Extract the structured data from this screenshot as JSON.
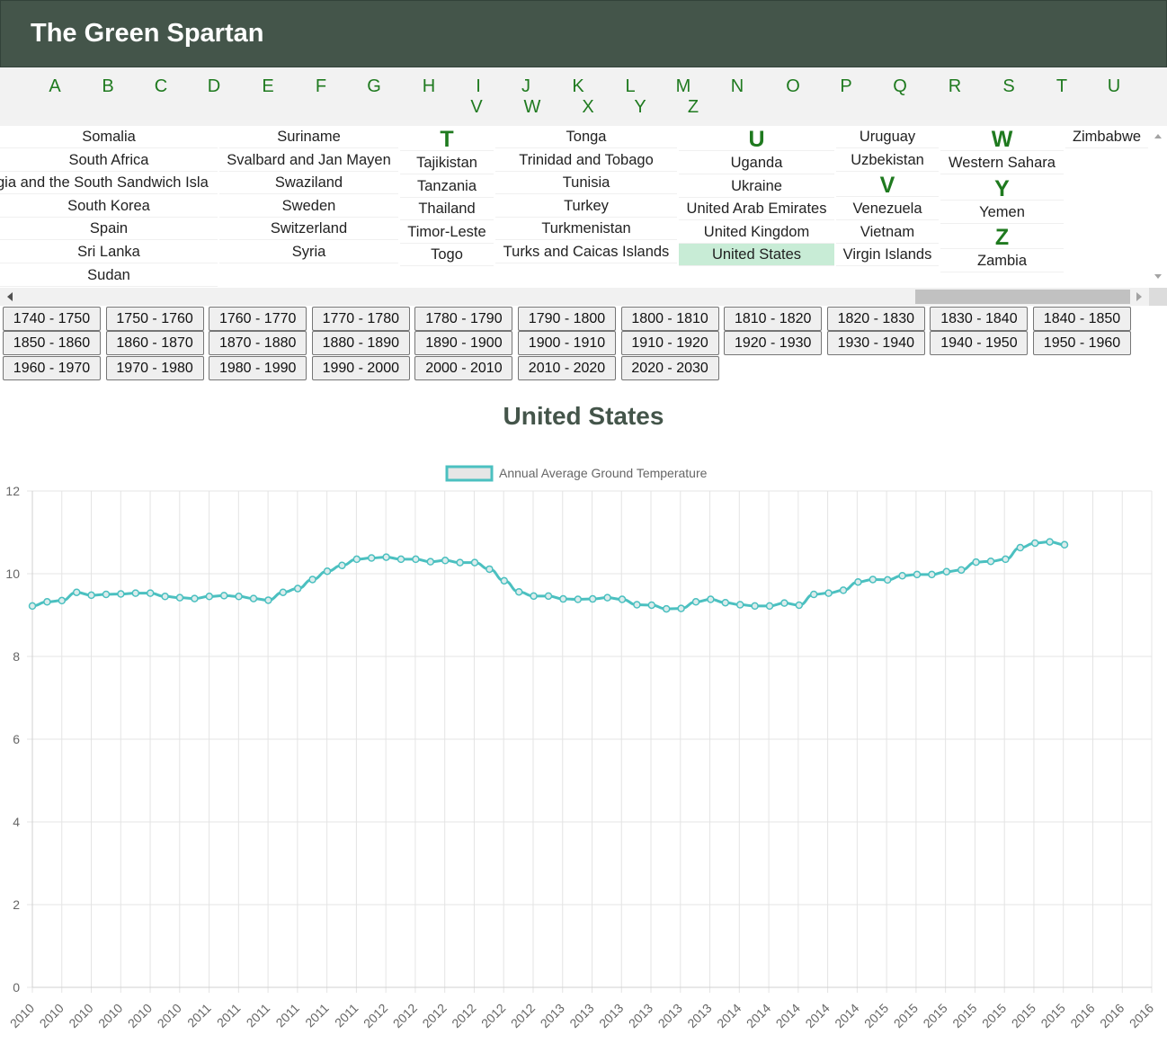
{
  "site": {
    "title": "The Green Spartan"
  },
  "alphabet": [
    "A",
    "B",
    "C",
    "D",
    "E",
    "F",
    "G",
    "H",
    "I",
    "J",
    "K",
    "L",
    "M",
    "N",
    "O",
    "P",
    "Q",
    "R",
    "S",
    "T",
    "U",
    "V",
    "W",
    "X",
    "Y",
    "Z"
  ],
  "country_columns": [
    {
      "entries": [
        {
          "type": "country",
          "name": "Somalia"
        },
        {
          "type": "country",
          "name": "South Africa"
        },
        {
          "type": "country",
          "name": "gia and the South Sandwich Isla"
        },
        {
          "type": "country",
          "name": "South Korea"
        },
        {
          "type": "country",
          "name": "Spain"
        },
        {
          "type": "country",
          "name": "Sri Lanka"
        },
        {
          "type": "country",
          "name": "Sudan"
        }
      ]
    },
    {
      "entries": [
        {
          "type": "country",
          "name": "Suriname"
        },
        {
          "type": "country",
          "name": "Svalbard and Jan Mayen"
        },
        {
          "type": "country",
          "name": "Swaziland"
        },
        {
          "type": "country",
          "name": "Sweden"
        },
        {
          "type": "country",
          "name": "Switzerland"
        },
        {
          "type": "country",
          "name": "Syria"
        }
      ]
    },
    {
      "entries": [
        {
          "type": "letter",
          "name": "T"
        },
        {
          "type": "country",
          "name": "Tajikistan"
        },
        {
          "type": "country",
          "name": "Tanzania"
        },
        {
          "type": "country",
          "name": "Thailand"
        },
        {
          "type": "country",
          "name": "Timor-Leste"
        },
        {
          "type": "country",
          "name": "Togo"
        }
      ]
    },
    {
      "entries": [
        {
          "type": "country",
          "name": "Tonga"
        },
        {
          "type": "country",
          "name": "Trinidad and Tobago"
        },
        {
          "type": "country",
          "name": "Tunisia"
        },
        {
          "type": "country",
          "name": "Turkey"
        },
        {
          "type": "country",
          "name": "Turkmenistan"
        },
        {
          "type": "country",
          "name": "Turks and Caicas Islands"
        }
      ]
    },
    {
      "entries": [
        {
          "type": "letter",
          "name": "U"
        },
        {
          "type": "country",
          "name": "Uganda"
        },
        {
          "type": "country",
          "name": "Ukraine"
        },
        {
          "type": "country",
          "name": "United Arab Emirates"
        },
        {
          "type": "country",
          "name": "United Kingdom"
        },
        {
          "type": "country",
          "name": "United States",
          "selected": true
        }
      ]
    },
    {
      "entries": [
        {
          "type": "country",
          "name": "Uruguay"
        },
        {
          "type": "country",
          "name": "Uzbekistan"
        },
        {
          "type": "letter",
          "name": "V"
        },
        {
          "type": "country",
          "name": "Venezuela"
        },
        {
          "type": "country",
          "name": "Vietnam"
        },
        {
          "type": "country",
          "name": "Virgin Islands"
        }
      ]
    },
    {
      "entries": [
        {
          "type": "letter",
          "name": "W"
        },
        {
          "type": "country",
          "name": "Western Sahara"
        },
        {
          "type": "letter",
          "name": "Y"
        },
        {
          "type": "country",
          "name": "Yemen"
        },
        {
          "type": "letter",
          "name": "Z"
        },
        {
          "type": "country",
          "name": "Zambia"
        }
      ]
    },
    {
      "entries": [
        {
          "type": "country",
          "name": "Zimbabwe"
        }
      ]
    }
  ],
  "decades": [
    "1740 - 1750",
    "1750 - 1760",
    "1760 - 1770",
    "1770 - 1780",
    "1780 - 1790",
    "1790 - 1800",
    "1800 - 1810",
    "1810 - 1820",
    "1820 - 1830",
    "1830 - 1840",
    "1840 - 1850",
    "1850 - 1860",
    "1860 - 1870",
    "1870 - 1880",
    "1880 - 1890",
    "1890 - 1900",
    "1900 - 1910",
    "1910 - 1920",
    "1920 - 1930",
    "1930 - 1940",
    "1940 - 1950",
    "1950 - 1960",
    "1960 - 1970",
    "1970 - 1980",
    "1980 - 1990",
    "1990 - 2000",
    "2000 - 2010",
    "2010 - 2020",
    "2020 - 2030"
  ],
  "chart_data": {
    "type": "line",
    "title": "United States",
    "xlabel": "",
    "ylabel": "",
    "ylim": [
      0,
      12
    ],
    "yticks": [
      0,
      2,
      4,
      6,
      8,
      10,
      12
    ],
    "grid": true,
    "legend_placement": "top",
    "x": [
      "2010",
      "2010",
      "2010",
      "2010",
      "2010",
      "2010",
      "2011",
      "2011",
      "2011",
      "2011",
      "2011",
      "2011",
      "2012",
      "2012",
      "2012",
      "2012",
      "2012",
      "2012",
      "2013",
      "2013",
      "2013",
      "2013",
      "2013",
      "2013",
      "2014",
      "2014",
      "2014",
      "2014",
      "2014",
      "2015",
      "2015",
      "2015",
      "2015",
      "2015",
      "2015",
      "2015",
      "2016",
      "2016",
      "2016"
    ],
    "series": [
      {
        "name": "Annual Average Ground Temperature",
        "color": "#4bc0c0",
        "values": [
          9.22,
          9.32,
          9.35,
          9.55,
          9.48,
          9.5,
          9.51,
          9.53,
          9.53,
          9.45,
          9.42,
          9.4,
          9.45,
          9.47,
          9.45,
          9.4,
          9.36,
          9.55,
          9.64,
          9.86,
          10.06,
          10.2,
          10.35,
          10.38,
          10.4,
          10.35,
          10.35,
          10.29,
          10.32,
          10.27,
          10.27,
          10.11,
          9.83,
          9.56,
          9.46,
          9.46,
          9.39,
          9.38,
          9.39,
          9.42,
          9.38,
          9.25,
          9.24,
          9.15,
          9.16,
          9.32,
          9.38,
          9.3,
          9.25,
          9.22,
          9.22,
          9.29,
          9.24,
          9.5,
          9.53,
          9.6,
          9.8,
          9.86,
          9.85,
          9.95,
          9.98,
          9.98,
          10.05,
          10.09,
          10.28,
          10.3,
          10.35,
          10.63,
          10.74,
          10.77,
          10.7
        ]
      }
    ]
  }
}
